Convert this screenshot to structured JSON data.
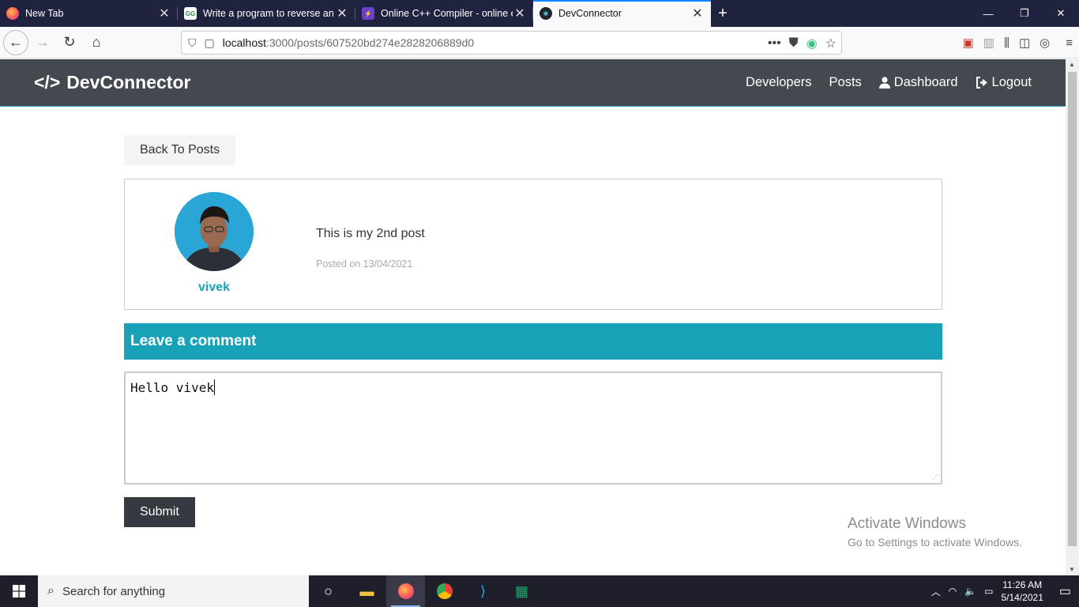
{
  "browser": {
    "tabs": [
      {
        "title": "New Tab",
        "icon": "firefox-icon",
        "active": false
      },
      {
        "title": "Write a program to reverse an a",
        "icon": "gfg-icon",
        "active": false
      },
      {
        "title": "Online C++ Compiler - online e",
        "icon": "compiler-icon",
        "active": false
      },
      {
        "title": "DevConnector",
        "icon": "react-icon",
        "active": true
      }
    ],
    "url_host": "localhost",
    "url_path": ":3000/posts/607520bd274e2828206889d0",
    "colors": {
      "tabbar": "#202340",
      "active_tab_line": "#0a84ff"
    }
  },
  "app": {
    "brand": "DevConnector",
    "nav": {
      "developers": "Developers",
      "posts": "Posts",
      "dashboard": "Dashboard",
      "logout": "Logout"
    },
    "colors": {
      "primary": "#17a2b8",
      "dark": "#343a40",
      "light": "#f4f4f4"
    }
  },
  "main": {
    "back_label": "Back To Posts",
    "post": {
      "user": "vivek",
      "text": "This is my 2nd post",
      "date": "Posted on 13/04/2021"
    },
    "comment_header": "Leave a comment",
    "comment_value": "Hello vivek",
    "submit_label": "Submit"
  },
  "watermark": {
    "line1": "Activate Windows",
    "line2": "Go to Settings to activate Windows."
  },
  "taskbar": {
    "search_placeholder": "Search for anything",
    "time": "11:26 AM",
    "date": "5/14/2021"
  }
}
